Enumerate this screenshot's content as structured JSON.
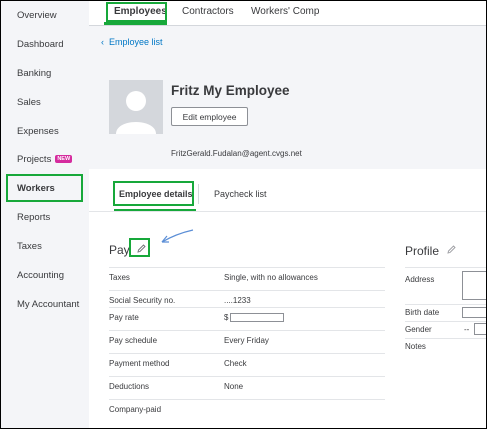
{
  "sidebar": {
    "items": [
      {
        "label": "Overview"
      },
      {
        "label": "Dashboard"
      },
      {
        "label": "Banking"
      },
      {
        "label": "Sales"
      },
      {
        "label": "Expenses"
      },
      {
        "label": "Projects",
        "badge": "NEW"
      },
      {
        "label": "Workers"
      },
      {
        "label": "Reports"
      },
      {
        "label": "Taxes"
      },
      {
        "label": "Accounting"
      },
      {
        "label": "My Accountant"
      }
    ]
  },
  "top_tabs": [
    {
      "label": "Employees"
    },
    {
      "label": "Contractors"
    },
    {
      "label": "Workers' Comp"
    }
  ],
  "breadcrumb": {
    "arrow": "‹",
    "label": "Employee list"
  },
  "employee": {
    "name": "Fritz My Employee",
    "edit_label": "Edit employee",
    "email": "FritzGerald.Fudalan@agent.cvgs.net"
  },
  "detail_tabs": [
    {
      "label": "Employee details"
    },
    {
      "label": "Paycheck list"
    }
  ],
  "pay": {
    "title": "Pay",
    "rows": [
      {
        "label": "Taxes",
        "value": "Single, with no allowances"
      },
      {
        "label": "Social Security no.",
        "value": "....1233"
      },
      {
        "label": "Pay rate",
        "value": "$"
      },
      {
        "label": "Pay schedule",
        "value": "Every Friday"
      },
      {
        "label": "Payment method",
        "value": "Check"
      },
      {
        "label": "Deductions",
        "value": "None"
      },
      {
        "label": "Company-paid",
        "value": ""
      }
    ]
  },
  "profile": {
    "title": "Profile",
    "rows": [
      {
        "label": "Address",
        "value": ""
      },
      {
        "label": "Birth date",
        "value": ""
      },
      {
        "label": "Gender",
        "value": "--"
      },
      {
        "label": "Notes",
        "value": ""
      }
    ]
  },
  "colors": {
    "highlight": "#17a83a",
    "link": "#0077c5",
    "badge": "#d52b9e",
    "annotation_arrow": "#5b8ed6"
  },
  "icons": {
    "pencil": "pencil-icon",
    "avatar": "person-silhouette-icon",
    "annotation": "arrow-annotation-icon"
  }
}
